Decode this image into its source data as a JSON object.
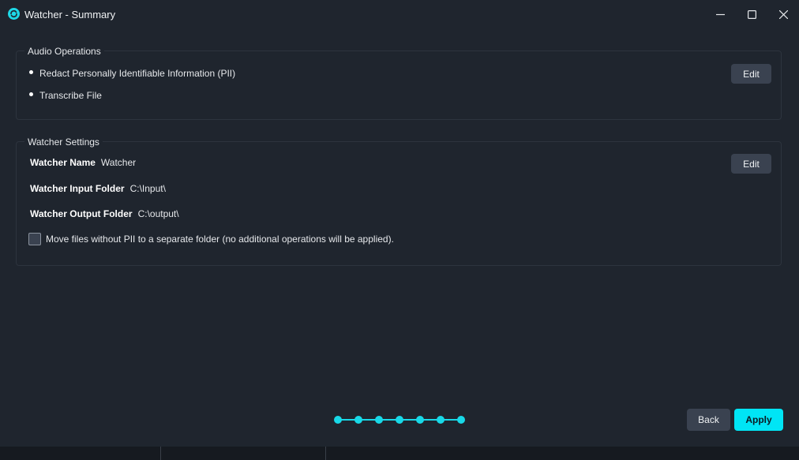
{
  "window": {
    "title": "Watcher - Summary",
    "app_icon": "swirl-app-icon",
    "controls": [
      "minimize-icon",
      "maximize-icon",
      "close-icon"
    ]
  },
  "audio_operations": {
    "legend": "Audio Operations",
    "items": [
      "Redact Personally Identifiable Information (PII)",
      "Transcribe File"
    ],
    "edit_label": "Edit"
  },
  "watcher_settings": {
    "legend": "Watcher Settings",
    "edit_label": "Edit",
    "fields": [
      {
        "label": "Watcher Name",
        "value": "Watcher"
      },
      {
        "label": "Watcher Input Folder",
        "value": "C:\\Input\\"
      },
      {
        "label": "Watcher Output Folder",
        "value": "C:\\output\\"
      }
    ],
    "move_files_checkbox": {
      "label": "Move files without PII to a separate folder (no additional operations will be applied).",
      "checked": false
    }
  },
  "stepper": {
    "total_steps": 7,
    "current_step": 7
  },
  "footer": {
    "back_label": "Back",
    "apply_label": "Apply"
  },
  "colors": {
    "background": "#1f252e",
    "accent": "#00e5f5",
    "button": "#3a4250",
    "panel_border": "#2d343e"
  }
}
